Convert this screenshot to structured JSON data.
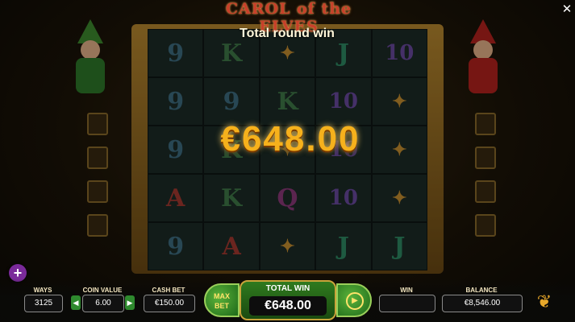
{
  "game": {
    "logo_text": "CAROL of the ELVES"
  },
  "overlay": {
    "round_label": "Total round win",
    "big_win": "€648.00"
  },
  "reels": [
    [
      "9",
      "K",
      "pic",
      "J",
      "10"
    ],
    [
      "9",
      "9",
      "K",
      "10",
      "pic"
    ],
    [
      "9",
      "K",
      "pic",
      "10",
      "pic"
    ],
    [
      "A",
      "K",
      "Q",
      "10",
      "pic"
    ],
    [
      "9",
      "A",
      "pic",
      "J",
      "J"
    ]
  ],
  "icons": {
    "close": "close-icon",
    "plus": "plus-icon",
    "spin": "spin-icon",
    "logo": "yggdrasil-logo-icon"
  },
  "hud": {
    "ways_label": "WAYS",
    "ways_value": "3125",
    "coin_label": "COIN VALUE",
    "coin_value": "6.00",
    "cash_label": "CASH BET",
    "cash_value": "€150.00",
    "maxbet_label": "MAX BET",
    "total_label": "TOTAL WIN",
    "total_value": "€648.00",
    "win_label": "WIN",
    "win_value": "",
    "balance_label": "BALANCE",
    "balance_value": "€8,546.00"
  }
}
